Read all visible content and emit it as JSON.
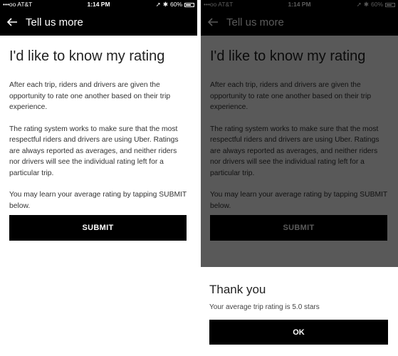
{
  "status_bar": {
    "carrier": "•••oo AT&T",
    "time": "1:14 PM",
    "battery": "60%",
    "battery_level": 0.6
  },
  "header": {
    "title": "Tell us more"
  },
  "main": {
    "heading": "I'd like to know my rating",
    "paragraphs": [
      "After each trip, riders and drivers are given the opportunity to rate one another based on their trip experience.",
      "The rating system works to make sure that the most respectful riders and drivers are using Uber. Ratings are always reported as averages, and neither riders nor drivers will see the individual rating left for a particular trip.",
      "You may learn your average rating by tapping SUBMIT below."
    ],
    "submit_label": "SUBMIT"
  },
  "dialog": {
    "title": "Thank you",
    "message": "Your average trip rating is 5.0 stars",
    "ok_label": "OK"
  }
}
